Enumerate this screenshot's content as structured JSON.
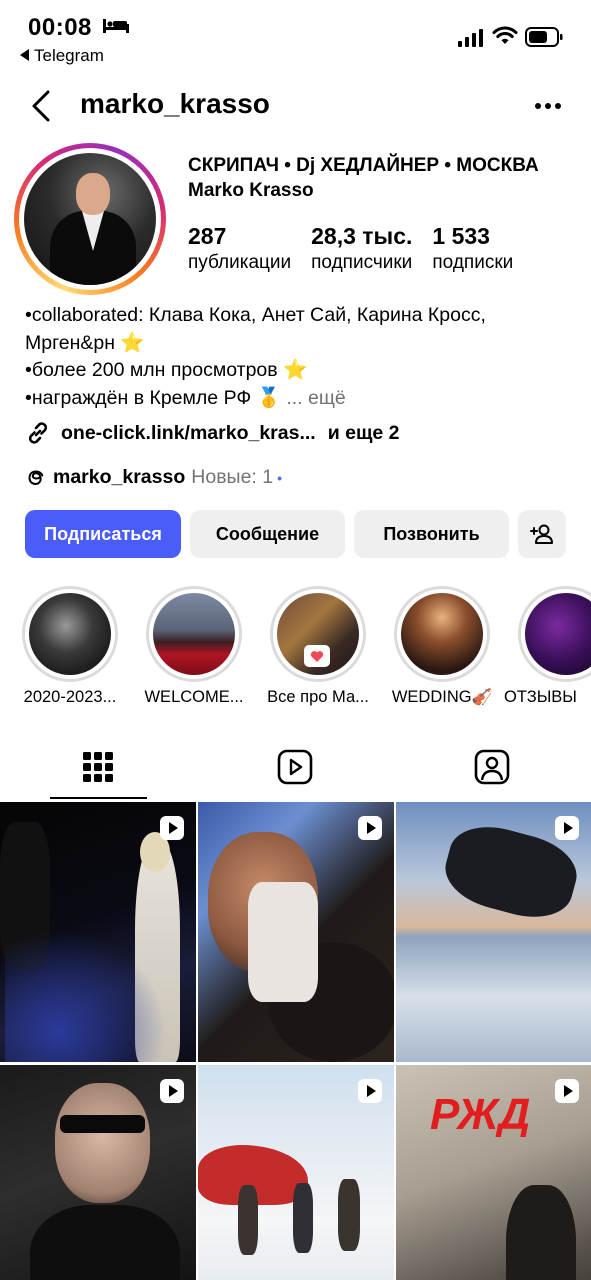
{
  "status_bar": {
    "time": "00:08",
    "back_app": "Telegram"
  },
  "header": {
    "username": "marko_krasso"
  },
  "profile": {
    "display_name": "СКРИПАЧ • Dj ХЕДЛАЙНЕР • МОСКВА Marko Krasso",
    "stats": [
      {
        "value": "287",
        "label": "публикации"
      },
      {
        "value": "28,3 тыс.",
        "label": "подписчики"
      },
      {
        "value": "1 533",
        "label": "подписки"
      }
    ],
    "bio_lines": [
      "•collaborated: Клава Кока, Анет Сай, Карина Кросс,",
      "Мрген&рн ⭐",
      "•более 200 млн просмотров ⭐",
      "•награждён в Кремле РФ 🥇"
    ],
    "bio_more": "... ещё",
    "link": "one-click.link/marko_kras...",
    "link_more": "и еще 2",
    "threads_handle": "marko_krasso",
    "threads_new": "Новые: 1",
    "threads_dot": "•"
  },
  "actions": {
    "follow": "Подписаться",
    "message": "Сообщение",
    "call": "Позвонить"
  },
  "highlights": [
    {
      "label": "2020-2023..."
    },
    {
      "label": "WELCOME..."
    },
    {
      "label": "Все про Ма..."
    },
    {
      "label": "WEDDING🎻"
    },
    {
      "label": "ОТЗЫВЫ"
    }
  ],
  "grid_overlay": {
    "logo_text": "РЖД"
  },
  "colors": {
    "primary_button": "#4a5df9",
    "secondary_button": "#efefef",
    "muted_text": "#737373"
  }
}
